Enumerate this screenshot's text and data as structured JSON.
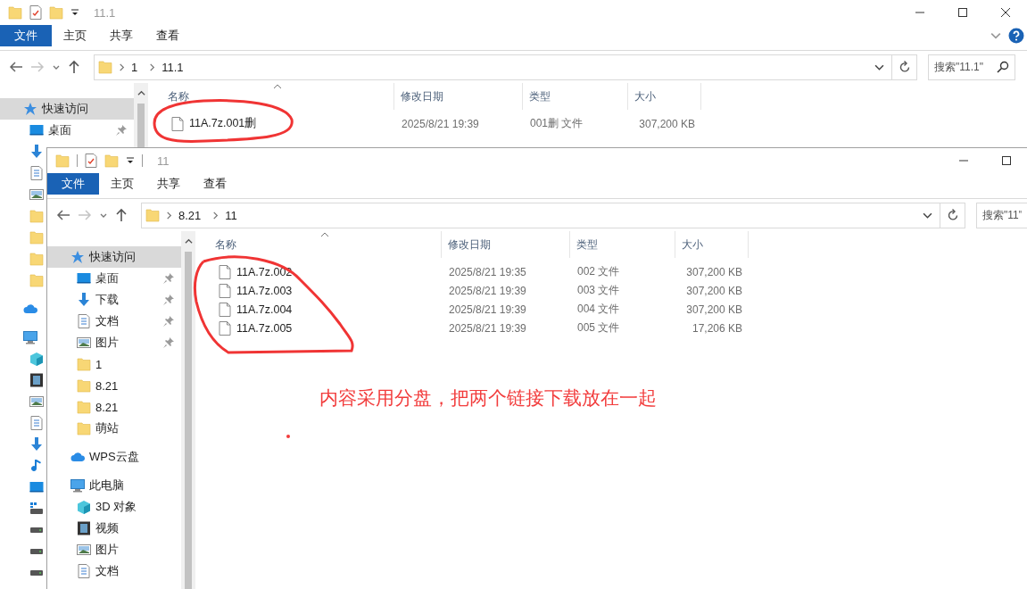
{
  "windows": [
    {
      "title": "11.1",
      "controls": [
        {
          "kind": "minimize"
        },
        {
          "kind": "maximize"
        },
        {
          "kind": "close"
        }
      ],
      "ribbon": {
        "tabs": [
          {
            "label": "文件",
            "kind": "menu"
          },
          {
            "label": "主页",
            "kind": "tab"
          },
          {
            "label": "共享",
            "kind": "tab"
          },
          {
            "label": "查看",
            "kind": "tab"
          }
        ],
        "help": true
      },
      "address": {
        "crumbs": [
          "1",
          "11.1"
        ]
      },
      "search": {
        "placeholder": "搜索\"11.1\"",
        "icon": true
      },
      "sidebar": {
        "items": [
          {
            "label": "快速访问",
            "kind": "quick",
            "selected": true,
            "children": [
              {
                "label": "桌面",
                "kind": "desktop",
                "selected": false,
                "pinned": true
              },
              {
                "kind": "download",
                "selected": false
              },
              {
                "kind": "document",
                "selected": false
              },
              {
                "kind": "picture",
                "selected": false
              },
              {
                "kind": "folder",
                "selected": false
              },
              {
                "kind": "folder",
                "selected": false
              },
              {
                "kind": "folder",
                "selected": false
              },
              {
                "kind": "folder",
                "selected": false
              }
            ]
          },
          {
            "kind": "cloud",
            "selected": false
          },
          {
            "kind": "pc",
            "selected": false,
            "children": [
              {
                "kind": "cube",
                "selected": false
              },
              {
                "kind": "video",
                "selected": false
              },
              {
                "kind": "picture",
                "selected": false
              },
              {
                "kind": "document",
                "selected": false
              },
              {
                "kind": "download",
                "selected": false
              },
              {
                "kind": "music",
                "selected": false
              },
              {
                "kind": "desktop",
                "selected": false
              },
              {
                "kind": "drive-win",
                "selected": false
              },
              {
                "kind": "drive",
                "selected": false
              },
              {
                "kind": "drive",
                "selected": false
              },
              {
                "kind": "drive",
                "selected": false
              }
            ]
          }
        ]
      },
      "columns": [
        "名称",
        "修改日期",
        "类型",
        "大小"
      ],
      "files": [
        {
          "name": "11A.7z.001删",
          "date": "2025/8/21 19:39",
          "type": "001删 文件",
          "size": "307,200 KB"
        }
      ]
    },
    {
      "title": "11",
      "controls": [
        {
          "kind": "minimize"
        },
        {
          "kind": "maximize"
        }
      ],
      "ribbon": {
        "tabs": [
          {
            "label": "文件",
            "kind": "menu"
          },
          {
            "label": "主页",
            "kind": "tab"
          },
          {
            "label": "共享",
            "kind": "tab"
          },
          {
            "label": "查看",
            "kind": "tab"
          }
        ],
        "help": false
      },
      "address": {
        "crumbs": [
          "8.21",
          "11"
        ]
      },
      "search": {
        "placeholder": "搜索\"11\"",
        "icon": false
      },
      "sidebar": {
        "items": [
          {
            "label": "快速访问",
            "kind": "quick",
            "selected": true,
            "children": [
              {
                "label": "桌面",
                "kind": "desktop",
                "selected": false,
                "pinned": true
              },
              {
                "label": "下载",
                "kind": "download",
                "selected": false,
                "pinned": true
              },
              {
                "label": "文档",
                "kind": "document",
                "selected": false,
                "pinned": true
              },
              {
                "label": "图片",
                "kind": "picture",
                "selected": false,
                "pinned": true
              },
              {
                "label": "1",
                "kind": "folder",
                "selected": false,
                "pinned": false
              },
              {
                "label": "8.21",
                "kind": "folder",
                "selected": false,
                "pinned": false
              },
              {
                "label": "8.21",
                "kind": "folder",
                "selected": false,
                "pinned": false
              },
              {
                "label": "萌站",
                "kind": "folder",
                "selected": false,
                "pinned": false
              }
            ]
          },
          {
            "label": "WPS云盘",
            "kind": "cloud",
            "selected": false
          },
          {
            "label": "此电脑",
            "kind": "pc",
            "selected": false,
            "children": [
              {
                "label": "3D 对象",
                "kind": "cube",
                "selected": false
              },
              {
                "label": "视频",
                "kind": "video",
                "selected": false
              },
              {
                "label": "图片",
                "kind": "picture",
                "selected": false
              },
              {
                "label": "文档",
                "kind": "document",
                "selected": false
              }
            ]
          }
        ]
      },
      "columns": [
        "名称",
        "修改日期",
        "类型",
        "大小"
      ],
      "files": [
        {
          "name": "11A.7z.002",
          "date": "2025/8/21 19:35",
          "type": "002 文件",
          "size": "307,200 KB"
        },
        {
          "name": "11A.7z.003",
          "date": "2025/8/21 19:39",
          "type": "003 文件",
          "size": "307,200 KB"
        },
        {
          "name": "11A.7z.004",
          "date": "2025/8/21 19:39",
          "type": "004 文件",
          "size": "307,200 KB"
        },
        {
          "name": "11A.7z.005",
          "date": "2025/8/21 19:39",
          "type": "005 文件",
          "size": "17,206 KB"
        }
      ]
    }
  ],
  "annotation": {
    "note": "内容采用分盘，把两个链接下载放在一起"
  }
}
